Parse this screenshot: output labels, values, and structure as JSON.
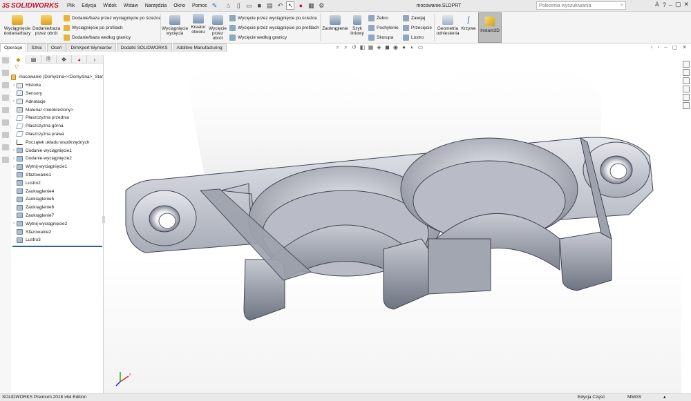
{
  "app": {
    "brand": "SOLIDWORKS",
    "logo_mark": "3S",
    "document_title": "mocowanie.SLDPRT"
  },
  "menu": [
    "Plik",
    "Edycja",
    "Widok",
    "Wstaw",
    "Narzędzia",
    "Okno",
    "Pomoc"
  ],
  "search": {
    "placeholder": "Polecenia wyszukiwania"
  },
  "ribbon": {
    "extrude_boss": "Wyciągnięcie dodania/bazy",
    "revolve_boss": "Dodanie/baza przez obrót",
    "sweep_boss": "Dodanie/baza przez wyciągnięcie po ścieżce",
    "loft_boss": "Wyciągnięcie po profilach",
    "boundary_boss": "Dodanie/baza według granicy",
    "extrude_cut": "Wyciągnięcie wycięcia",
    "hole_wizard": "Kreator otworu",
    "revolve_cut": "Wycięcie przez obrót",
    "sweep_cut": "Wycięcie przez wyciągnięcie po ścieżce",
    "loft_cut": "Wycięcie przez wyciągnięcie po profilach",
    "boundary_cut": "Wycięcie według granicy",
    "fillet": "Zaokrąglenie",
    "linear_pattern": "Szyk liniowy",
    "rib": "Żebro",
    "draft": "Pochylenie",
    "shell": "Skorupa",
    "wrap": "Zawijaj",
    "intersect": "Przecięcie",
    "mirror": "Lustro",
    "ref_geometry": "Geometria odniesienia",
    "curves": "Krzywe",
    "instant3d": "Instant3D"
  },
  "tabs": [
    "Operacje",
    "Szkic",
    "Oceń",
    "DimXpert Wymiarów",
    "Dodatki SOLIDWORKS",
    "Additive Manufacturing"
  ],
  "tree": {
    "root": "mocowanie (Domyślna<<Domyślna>_Star",
    "items": [
      {
        "label": "Historia",
        "icon": "history-icon",
        "exp": "›"
      },
      {
        "label": "Sensory",
        "icon": "sensor-icon",
        "exp": ""
      },
      {
        "label": "Adnotacje",
        "icon": "annotation-icon",
        "exp": "›"
      },
      {
        "label": "Materiał <nieokreślony>",
        "icon": "material-icon",
        "exp": ""
      },
      {
        "label": "Płaszczyzna przednia",
        "icon": "plane-icon",
        "exp": ""
      },
      {
        "label": "Płaszczyzna górna",
        "icon": "plane-icon",
        "exp": ""
      },
      {
        "label": "Płaszczyzna prawa",
        "icon": "plane-icon",
        "exp": ""
      },
      {
        "label": "Początek układu współrzędnych",
        "icon": "origin-icon",
        "exp": ""
      },
      {
        "label": "Dodanie-wyciągnięcie1",
        "icon": "extrude-icon",
        "exp": "›"
      },
      {
        "label": "Dodanie-wyciągnięcie2",
        "icon": "extrude-icon",
        "exp": "›"
      },
      {
        "label": "Wytnij-wyciągnięcie1",
        "icon": "cut-icon",
        "exp": "›"
      },
      {
        "label": "Sfazowanie1",
        "icon": "chamfer-icon",
        "exp": ""
      },
      {
        "label": "Lustro2",
        "icon": "mirror-icon",
        "exp": ""
      },
      {
        "label": "Zaokrąglenie4",
        "icon": "fillet-icon",
        "exp": ""
      },
      {
        "label": "Zaokrąglenie5",
        "icon": "fillet-icon",
        "exp": ""
      },
      {
        "label": "Zaokrąglenie6",
        "icon": "fillet-icon",
        "exp": ""
      },
      {
        "label": "Zaokrąglenie7",
        "icon": "fillet-icon",
        "exp": ""
      },
      {
        "label": "Wytnij-wyciągnięcie2",
        "icon": "cut-icon",
        "exp": "›"
      },
      {
        "label": "Sfazowanie2",
        "icon": "chamfer-icon",
        "exp": ""
      },
      {
        "label": "Lustro3",
        "icon": "mirror-icon",
        "exp": ""
      }
    ]
  },
  "status": {
    "edition": "SOLIDWORKS Premium 2018 x64 Edition",
    "mode": "Edycja Część",
    "units": "MMGS"
  }
}
